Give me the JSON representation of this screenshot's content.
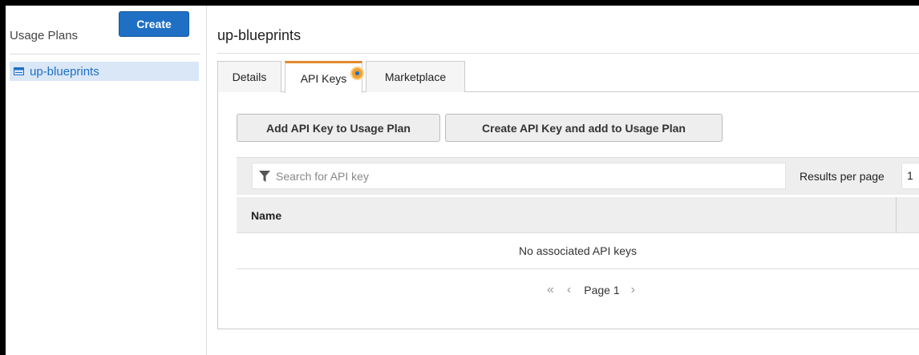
{
  "sidebar": {
    "title": "Usage Plans",
    "create_label": "Create",
    "items": [
      {
        "label": "up-blueprints",
        "icon": "usage-plan-icon",
        "selected": true
      }
    ]
  },
  "main": {
    "title": "up-blueprints",
    "tabs": [
      {
        "label": "Details"
      },
      {
        "label": "API Keys",
        "active": true
      },
      {
        "label": "Marketplace"
      }
    ],
    "buttons": {
      "add_key": "Add API Key to Usage Plan",
      "create_key": "Create API Key and add to Usage Plan"
    },
    "search": {
      "placeholder": "Search for API key"
    },
    "results_per_page": {
      "label": "Results per page",
      "value": "1"
    },
    "table": {
      "columns": [
        "Name"
      ],
      "empty_message": "No associated API keys"
    },
    "pagination": {
      "first": "«",
      "prev": "‹",
      "page_label": "Page 1",
      "next": "›"
    }
  },
  "colors": {
    "primary_button": "#1f6fc5",
    "active_tab_accent": "#e38a2c",
    "selected_item_bg": "#d9e7f7"
  }
}
